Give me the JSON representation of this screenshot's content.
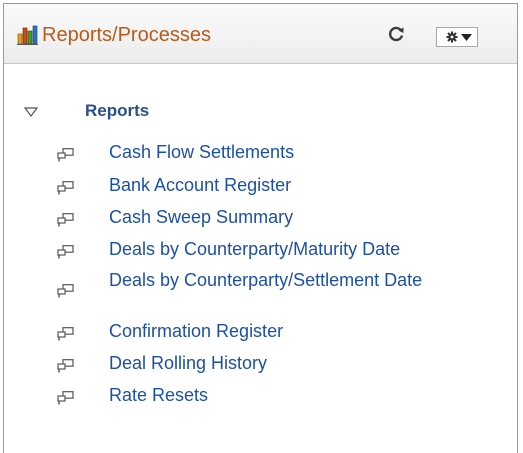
{
  "pagelet": {
    "title": "Reports/Processes",
    "icons": {
      "title": "bar-chart-icon",
      "refresh": "refresh-icon",
      "options": "gear-icon",
      "options_caret": "chevron-down-icon",
      "group_toggle": "triangle-down-icon",
      "item": "report-link-icon"
    },
    "colors": {
      "title": "#bb5a1a",
      "group": "#2a4f8a",
      "link": "#1c50a8"
    }
  },
  "group": {
    "label": "Reports",
    "expanded": true,
    "items": [
      {
        "label": "Cash Flow Settlements"
      },
      {
        "label": "Bank Account Register"
      },
      {
        "label": "Cash Sweep Summary"
      },
      {
        "label": "Deals by Counterparty/Maturity Date"
      },
      {
        "label": "Deals by Counterparty/Settlement Date"
      },
      {
        "label": "Confirmation Register"
      },
      {
        "label": "Deal Rolling History"
      },
      {
        "label": "Rate Resets"
      }
    ]
  }
}
